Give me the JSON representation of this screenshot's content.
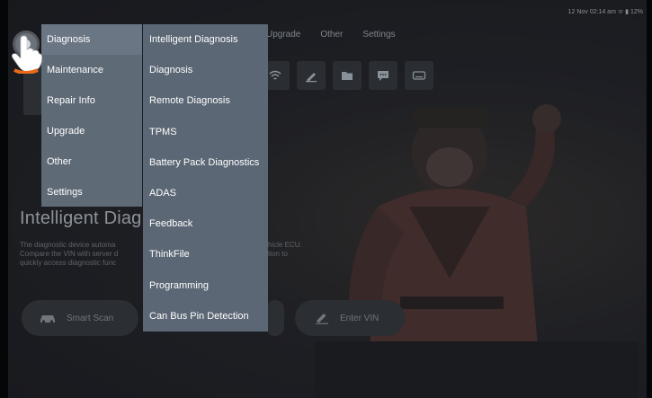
{
  "status_bar": {
    "text": "12 Nov 02:14 am ᯤ ▮ 12%"
  },
  "top_nav": [
    "Upgrade",
    "Other",
    "Settings"
  ],
  "main_menu": {
    "items": [
      {
        "label": "Diagnosis",
        "active": true
      },
      {
        "label": "Maintenance"
      },
      {
        "label": "Repair Info"
      },
      {
        "label": "Upgrade"
      },
      {
        "label": "Other"
      },
      {
        "label": "Settings"
      }
    ]
  },
  "sub_menu": {
    "items": [
      "Intelligent Diagnosis",
      "Diagnosis",
      "Remote Diagnosis",
      "TPMS",
      "Battery Pack Diagnostics",
      "ADAS",
      "Feedback",
      "ThinkFile",
      "Programming",
      "Can Bus Pin Detection"
    ]
  },
  "hero": {
    "title": "Intelligent Diag",
    "description": "The diagnostic device automa\nCompare the VIN with server d\nquickly access diagnostic func",
    "description_right": "hicle ECU.\ntion to"
  },
  "buttons": {
    "smart_scan": "Smart Scan",
    "enter_vin": "Enter VIN"
  },
  "icons": {
    "toolbar": [
      "wifi-icon",
      "pencil-icon",
      "folder-icon",
      "chat-icon",
      "keyboard-icon"
    ]
  },
  "colors": {
    "menu_main": "#5f6a77",
    "menu_sub": "#5b6774",
    "menu_active": "#6b7684"
  }
}
